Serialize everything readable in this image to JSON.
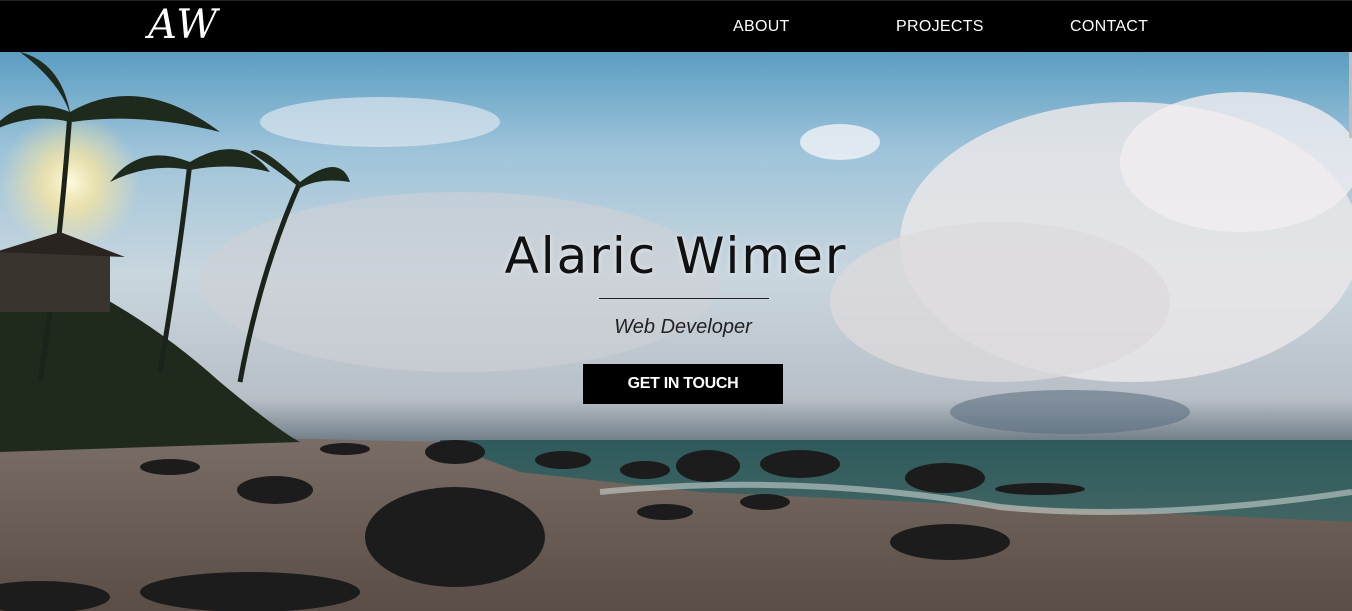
{
  "navbar": {
    "logo": "AW",
    "links": [
      "ABOUT",
      "PROJECTS",
      "CONTACT"
    ]
  },
  "hero": {
    "title": "Alaric Wimer",
    "subtitle": "Web Developer",
    "cta_label": "GET IN TOUCH",
    "background_image": "tropical-beach-photo"
  },
  "colors": {
    "navbar_bg": "#000000",
    "nav_text": "#ffffff",
    "cta_bg": "#000000",
    "cta_text": "#ffffff"
  }
}
